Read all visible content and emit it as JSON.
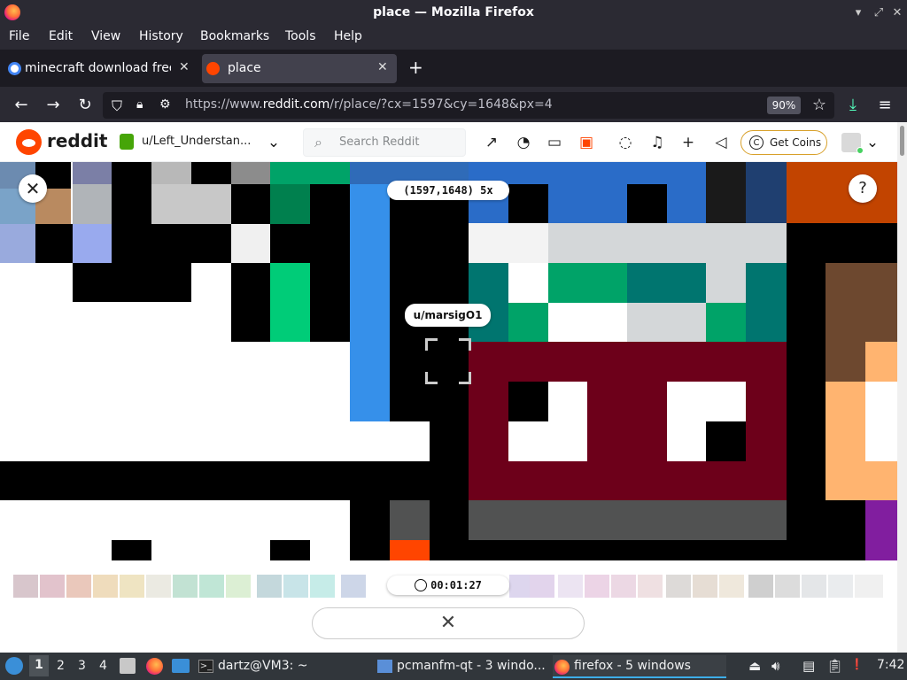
{
  "window": {
    "title": "place — Mozilla Firefox",
    "controls": [
      "minimize-icon",
      "maximize-icon",
      "close-icon"
    ]
  },
  "menu": {
    "items": [
      "File",
      "Edit",
      "View",
      "History",
      "Bookmarks",
      "Tools",
      "Help"
    ]
  },
  "tabs": [
    {
      "label": "minecraft download free",
      "active": false
    },
    {
      "label": "place",
      "active": true
    }
  ],
  "nav": {
    "url_prefix": "https://www.",
    "url_domain": "reddit.com",
    "url_rest": "/r/place/?cx=1597&cy=1648&px=4",
    "zoom": "90%"
  },
  "reddit": {
    "wordmark": "reddit",
    "user_label": "u/Left_Understan...",
    "search_placeholder": "Search Reddit",
    "coins_label": "Get Coins"
  },
  "place": {
    "coordinates": "(1597,1648) 5x",
    "hover_user": "u/marsigO1",
    "timer": "00:01:27"
  },
  "colors": {
    "dark_red": "#6d001a",
    "teal": "#00756f",
    "green": "#00a368",
    "light_green": "#00cc78",
    "blue": "#3690ea",
    "orange": "#ffb470",
    "brown": "#6d482f",
    "purple": "#811e9f",
    "gray": "#515252",
    "light_gray": "#d4d7d9"
  },
  "taskbar": {
    "workspaces": [
      "1",
      "2",
      "3",
      "4"
    ],
    "tasks": [
      {
        "label": "dartz@VM3: ~"
      },
      {
        "label": "pcmanfm-qt - 3 windo..."
      },
      {
        "label": "firefox - 5 windows"
      }
    ],
    "clock": "7:42"
  }
}
